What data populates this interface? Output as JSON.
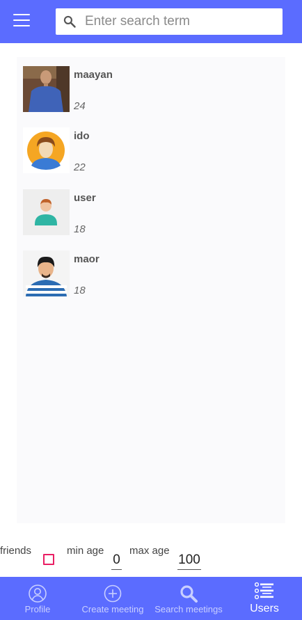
{
  "search": {
    "placeholder": "Enter search term"
  },
  "users": [
    {
      "name": "maayan",
      "age": "24"
    },
    {
      "name": "ido",
      "age": "22"
    },
    {
      "name": "user",
      "age": "18"
    },
    {
      "name": "maor",
      "age": "18"
    }
  ],
  "filters": {
    "friends_label": "friends",
    "friends_checked": false,
    "min_age_label": "min age",
    "min_age_value": "0",
    "max_age_label": "max age",
    "max_age_value": "100"
  },
  "nav": [
    {
      "label": "Profile",
      "icon": "person-circle-icon"
    },
    {
      "label": "Create meeting",
      "icon": "add-circle-icon"
    },
    {
      "label": "Search meetings",
      "icon": "search-icon"
    },
    {
      "label": "Users",
      "icon": "list-icon",
      "active": true
    }
  ],
  "colors": {
    "primary": "#5b6cff",
    "checkbox": "#e91e63"
  }
}
